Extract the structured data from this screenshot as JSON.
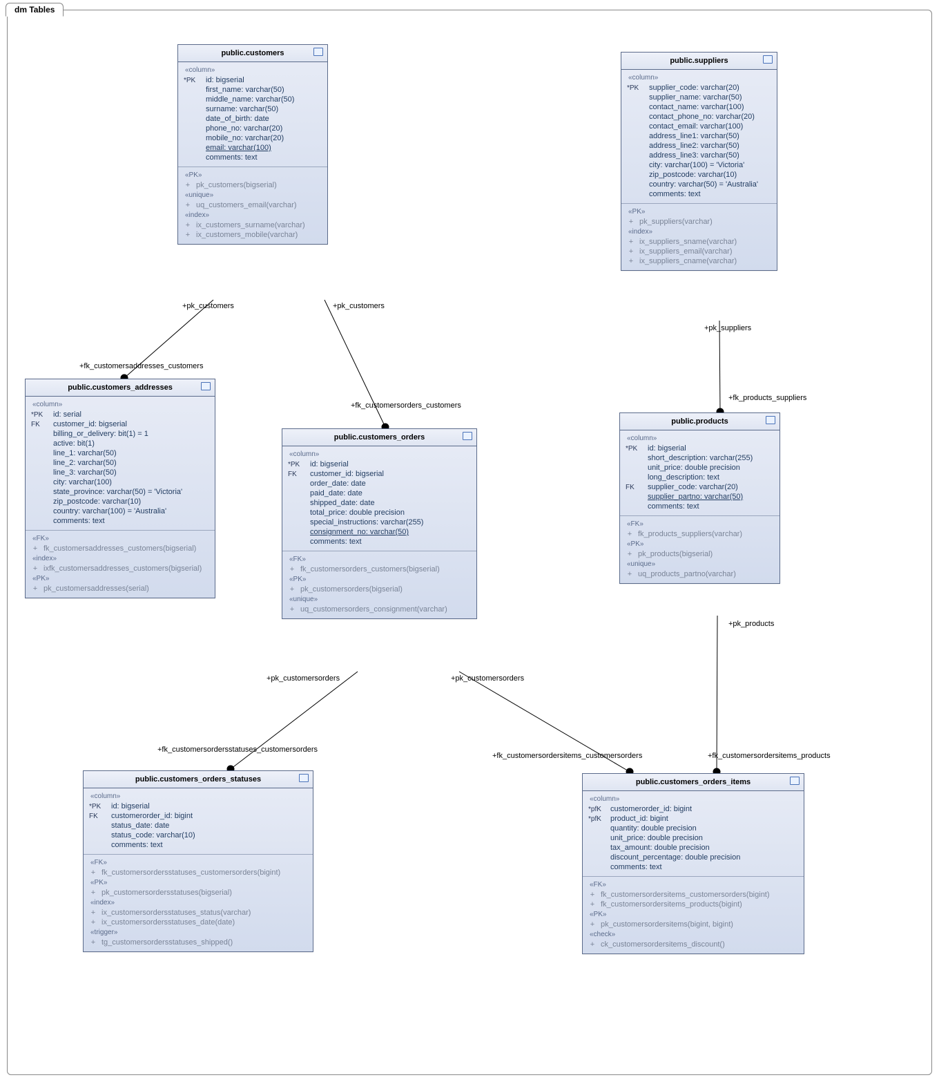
{
  "frame": {
    "title": "dm Tables"
  },
  "entity": {
    "customers": {
      "title": "public.customers",
      "s_column": "«column»",
      "c0p": "*PK",
      "c0": "id: bigserial",
      "c1": "first_name: varchar(50)",
      "c2": "middle_name: varchar(50)",
      "c3": "surname: varchar(50)",
      "c4": "date_of_birth: date",
      "c5": "phone_no: varchar(20)",
      "c6": "mobile_no: varchar(20)",
      "c7": "email: varchar(100)",
      "c8": "comments: text",
      "s_pk": "«PK»",
      "pk0": "pk_customers(bigserial)",
      "s_unique": "«unique»",
      "u0": "uq_customers_email(varchar)",
      "s_index": "«index»",
      "i0": "ix_customers_surname(varchar)",
      "i1": "ix_customers_mobile(varchar)"
    },
    "customers_addresses": {
      "title": "public.customers_addresses",
      "s_column": "«column»",
      "c0p": "*PK",
      "c0": "id: serial",
      "c1p": "FK",
      "c1": "customer_id: bigserial",
      "c2": "billing_or_delivery: bit(1) = 1",
      "c3": "active: bit(1)",
      "c4": "line_1: varchar(50)",
      "c5": "line_2: varchar(50)",
      "c6": "line_3: varchar(50)",
      "c7": "city: varchar(100)",
      "c8": "state_province: varchar(50) = 'Victoria'",
      "c9": "zip_postcode: varchar(10)",
      "c10": "country: varchar(100) = 'Australia'",
      "c11": "comments: text",
      "s_fk": "«FK»",
      "f0": "fk_customersaddresses_customers(bigserial)",
      "s_index": "«index»",
      "i0": "ixfk_customersaddresses_customers(bigserial)",
      "s_pk": "«PK»",
      "pk0": "pk_customersaddresses(serial)"
    },
    "customers_orders": {
      "title": "public.customers_orders",
      "s_column": "«column»",
      "c0p": "*PK",
      "c0": "id: bigserial",
      "c1p": "FK",
      "c1": "customer_id: bigserial",
      "c2": "order_date: date",
      "c3": "paid_date: date",
      "c4": "shipped_date: date",
      "c5": "total_price: double precision",
      "c6": "special_instructions: varchar(255)",
      "c7": "consignment_no: varchar(50)",
      "c8": "comments: text",
      "s_fk": "«FK»",
      "f0": "fk_customersorders_customers(bigserial)",
      "s_pk": "«PK»",
      "pk0": "pk_customersorders(bigserial)",
      "s_unique": "«unique»",
      "u0": "uq_customersorders_consignment(varchar)"
    },
    "customers_orders_statuses": {
      "title": "public.customers_orders_statuses",
      "s_column": "«column»",
      "c0p": "*PK",
      "c0": "id: bigserial",
      "c1p": "FK",
      "c1": "customerorder_id: bigint",
      "c2": "status_date: date",
      "c3": "status_code: varchar(10)",
      "c4": "comments: text",
      "s_fk": "«FK»",
      "f0": "fk_customersordersstatuses_customersorders(bigint)",
      "s_pk": "«PK»",
      "pk0": "pk_customersordersstatuses(bigserial)",
      "s_index": "«index»",
      "i0": "ix_customersordersstatuses_status(varchar)",
      "i1": "ix_customersordersstatuses_date(date)",
      "s_trigger": "«trigger»",
      "t0": "tg_customersordersstatuses_shipped()"
    },
    "suppliers": {
      "title": "public.suppliers",
      "s_column": "«column»",
      "c0p": "*PK",
      "c0": "supplier_code: varchar(20)",
      "c1": "supplier_name: varchar(50)",
      "c2": "contact_name: varchar(100)",
      "c3": "contact_phone_no: varchar(20)",
      "c4": "contact_email: varchar(100)",
      "c5": "address_line1: varchar(50)",
      "c6": "address_line2: varchar(50)",
      "c7": "address_line3: varchar(50)",
      "c8": "city: varchar(100) = 'Victoria'",
      "c9": "zip_postcode: varchar(10)",
      "c10": "country: varchar(50) = 'Australia'",
      "c11": "comments: text",
      "s_pk": "«PK»",
      "pk0": "pk_suppliers(varchar)",
      "s_index": "«index»",
      "i0": "ix_suppliers_sname(varchar)",
      "i1": "ix_suppliers_email(varchar)",
      "i2": "ix_suppliers_cname(varchar)"
    },
    "products": {
      "title": "public.products",
      "s_column": "«column»",
      "c0p": "*PK",
      "c0": "id: bigserial",
      "c1": "short_description: varchar(255)",
      "c2": "unit_price: double precision",
      "c3": "long_description: text",
      "c4p": "FK",
      "c4": "supplier_code: varchar(20)",
      "c5": "supplier_partno: varchar(50)",
      "c6": "comments: text",
      "s_fk": "«FK»",
      "f0": "fk_products_suppliers(varchar)",
      "s_pk": "«PK»",
      "pk0": "pk_products(bigserial)",
      "s_unique": "«unique»",
      "u0": "uq_products_partno(varchar)"
    },
    "customers_orders_items": {
      "title": "public.customers_orders_items",
      "s_column": "«column»",
      "c0p": "*pfK",
      "c0": "customerorder_id: bigint",
      "c1p": "*pfK",
      "c1": "product_id: bigint",
      "c2": "quantity: double precision",
      "c3": "unit_price: double precision",
      "c4": "tax_amount: double precision",
      "c5": "discount_percentage: double precision",
      "c6": "comments: text",
      "s_fk": "«FK»",
      "f0": "fk_customersordersitems_customersorders(bigint)",
      "f1": "fk_customersordersitems_products(bigint)",
      "s_pk": "«PK»",
      "pk0": "pk_customersordersitems(bigint, bigint)",
      "s_check": "«check»",
      "k0": "ck_customersordersitems_discount()"
    }
  },
  "labels": {
    "pk_customers1": "+pk_customers",
    "pk_customers2": "+pk_customers",
    "fk_ca_c": "+fk_customersaddresses_customers",
    "fk_co_c": "+fk_customersorders_customers",
    "pk_co1": "+pk_customersorders",
    "pk_co2": "+pk_customersorders",
    "fk_cos_co": "+fk_customersordersstatuses_customersorders",
    "fk_coi_co": "+fk_customersordersitems_customersorders",
    "pk_suppliers": "+pk_suppliers",
    "fk_p_s": "+fk_products_suppliers",
    "pk_products": "+pk_products",
    "fk_coi_p": "+fk_customersordersitems_products"
  }
}
